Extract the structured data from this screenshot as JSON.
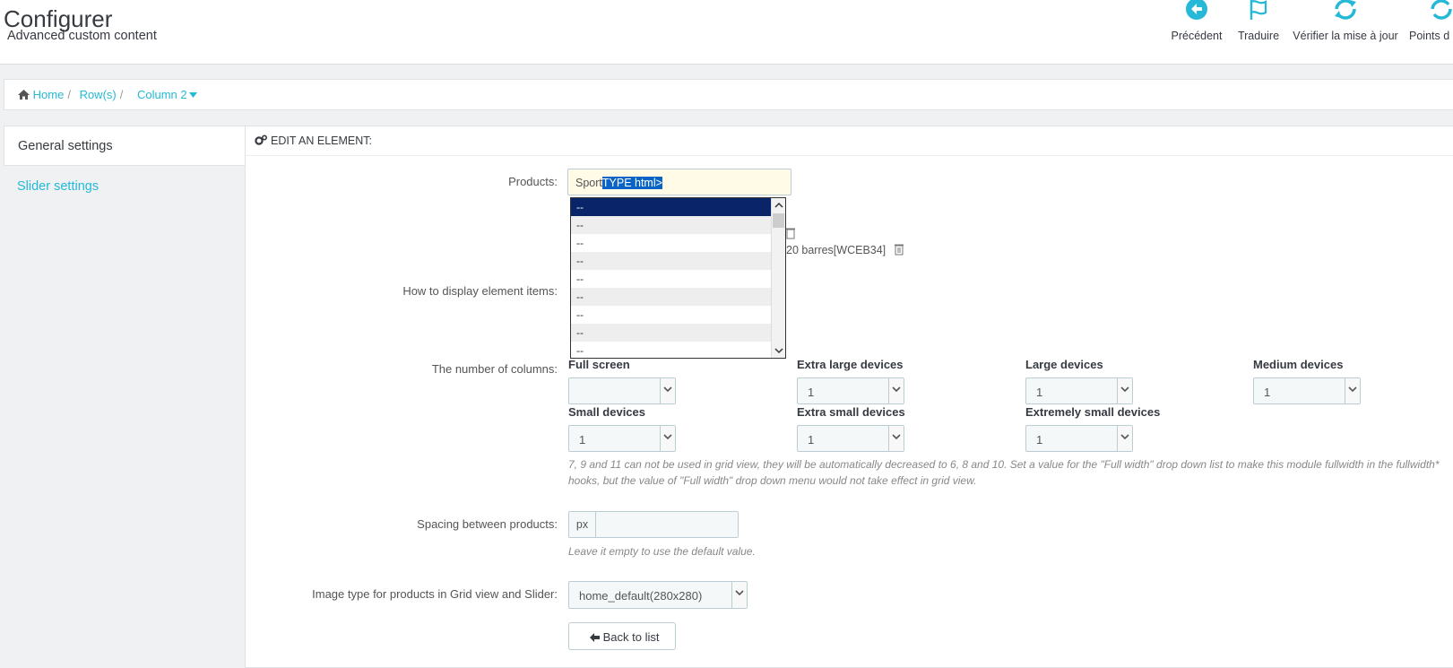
{
  "header": {
    "title": "Configurer",
    "subtitle": "Advanced custom content",
    "toolbar": [
      {
        "label": "Précédent",
        "icon": "arrow-circle-left-icon"
      },
      {
        "label": "Traduire",
        "icon": "flag-icon"
      },
      {
        "label": "Vérifier la mise à jour",
        "icon": "refresh-icon"
      },
      {
        "label": "Points d",
        "icon": "refresh-icon"
      }
    ]
  },
  "breadcrumb": {
    "home": "Home",
    "rows": "Row(s)",
    "column": "Column 2"
  },
  "tabs": {
    "general": "General settings",
    "slider": "Slider settings"
  },
  "panel": {
    "heading": "EDIT AN ELEMENT:",
    "products": {
      "label": "Products:",
      "value_plain": "Sport",
      "value_selected": "TYPE html>",
      "behind_text": "20 barres[WCEB34]",
      "options": [
        "--",
        "--",
        "--",
        "--",
        "--",
        "--",
        "--",
        "--",
        "--"
      ]
    },
    "display_label": "How to display element items:",
    "columns": {
      "label": "The number of columns:",
      "groups": [
        {
          "title": "Full screen",
          "value": ""
        },
        {
          "title": "Extra large devices",
          "value": "1"
        },
        {
          "title": "Large devices",
          "value": "1"
        },
        {
          "title": "Medium devices",
          "value": "1"
        },
        {
          "title": "Small devices",
          "value": "1"
        },
        {
          "title": "Extra small devices",
          "value": "1"
        },
        {
          "title": "Extremely small devices",
          "value": "1"
        }
      ],
      "help_line1": "7, 9 and 11 can not be used in grid view, they will be automatically decreased to 6, 8 and 10. Set a value for the \"Full width\" drop down list to make this module fullwidth in the fullwidth*",
      "help_line2": "hooks, but the value of \"Full width\" drop down menu would not take effect in grid view."
    },
    "spacing": {
      "label": "Spacing between products:",
      "addon": "px",
      "value": "",
      "help": "Leave it empty to use the default value."
    },
    "image_type": {
      "label": "Image type for products in Grid view and Slider:",
      "value": "home_default(280x280)"
    },
    "back_button": "Back to list"
  },
  "colors": {
    "accent": "#25b9d7",
    "selected_option": "#0a246a"
  }
}
